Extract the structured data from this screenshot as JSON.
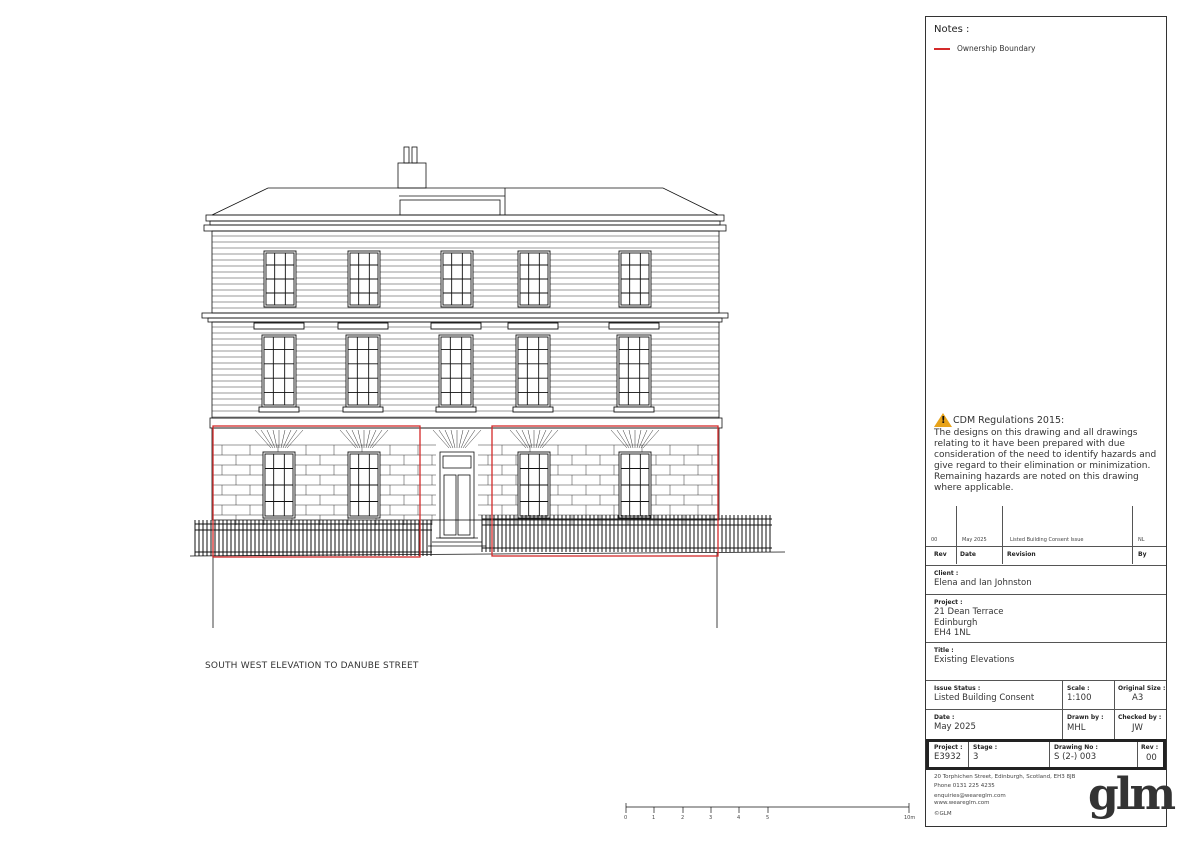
{
  "drawing": {
    "elevation_title": "SOUTH  WEST ELEVATION TO DANUBE STREET",
    "scale_bar_labels": [
      "0",
      "1",
      "2",
      "3",
      "4",
      "5",
      "10m"
    ]
  },
  "notes": {
    "heading": "Notes :",
    "legend_label": "Ownership Boundary",
    "legend_color": "#d42a2a",
    "cdm_title": "CDM Regulations 2015:",
    "cdm_text": "The designs on this drawing and all drawings relating to it have been prepared with due consideration of the need to identify hazards and give regard to their elimination or minimization. Remaining hazards are noted on this drawing where applicable."
  },
  "revisions": {
    "headers": {
      "rev": "Rev",
      "date": "Date",
      "revision": "Revision",
      "by": "By"
    },
    "rows": [
      {
        "rev": "00",
        "date": "May 2025",
        "revision": "Listed Building Consent Issue",
        "by": "NL"
      }
    ]
  },
  "client": {
    "label": "Client :",
    "value": "Elena and Ian Johnston"
  },
  "project": {
    "label": "Project :",
    "line1": "21 Dean Terrace",
    "line2": "Edinburgh",
    "line3": "EH4 1NL"
  },
  "title": {
    "label": "Title :",
    "value": "Existing Elevations"
  },
  "issue_status": {
    "label": "Issue Status :",
    "value": "Listed Building Consent"
  },
  "scale": {
    "label": "Scale :",
    "value": "1:100"
  },
  "original_size": {
    "label": "Original Size :",
    "value": "A3"
  },
  "date": {
    "label": "Date :",
    "value": "May 2025"
  },
  "drawn_by": {
    "label": "Drawn by :",
    "value": "MHL"
  },
  "checked_by": {
    "label": "Checked by :",
    "value": "JW"
  },
  "project_no": {
    "label": "Project :",
    "value": "E3932"
  },
  "stage": {
    "label": "Stage :",
    "value": "3"
  },
  "drawing_no": {
    "label": "Drawing No :",
    "value": "S (2-) 003"
  },
  "rev": {
    "label": "Rev :",
    "value": "00"
  },
  "company": {
    "address": "20 Torphichen Street, Edinburgh, Scotland, EH3 8JB",
    "phone": "Phone 0131 225 4235",
    "email": "enquiries@wearеglm.com",
    "web": "www.wearеglm.com",
    "copyright": "©GLM",
    "logo_text": "glm"
  }
}
